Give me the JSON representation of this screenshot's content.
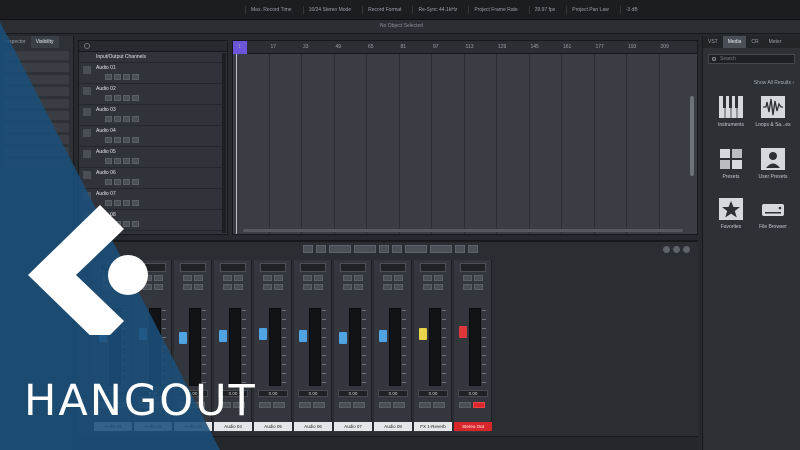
{
  "topbar": {
    "segments": [
      "Max. Record Time",
      "16/24 Stereo Mode",
      "Record Format",
      "Re-Sync 44.1kHz",
      "Project Frame Rate",
      "29.97 fps",
      "Project Pan Law",
      "-3 dB"
    ]
  },
  "subbar": {
    "status": "No Object Selected"
  },
  "inspector": {
    "tabs": [
      {
        "label": "Inspector"
      },
      {
        "label": "Visibility"
      }
    ]
  },
  "tracklist": {
    "folder_label": "Input/Output Channels",
    "tracks": [
      {
        "name": "Audio 01"
      },
      {
        "name": "Audio 02"
      },
      {
        "name": "Audio 03"
      },
      {
        "name": "Audio 04"
      },
      {
        "name": "Audio 05"
      },
      {
        "name": "Audio 06"
      },
      {
        "name": "Audio 07"
      },
      {
        "name": "Audio 08"
      }
    ]
  },
  "ruler": {
    "bars": [
      "1",
      "17",
      "33",
      "49",
      "65",
      "81",
      "97",
      "113",
      "129",
      "145",
      "161",
      "177",
      "193",
      "209"
    ]
  },
  "media": {
    "tabs": [
      {
        "label": "VST"
      },
      {
        "label": "Media"
      },
      {
        "label": "CR"
      },
      {
        "label": "Meter"
      }
    ],
    "search_placeholder": "Search",
    "show_all_link": "Show All Results ›",
    "items": [
      {
        "label": "Instruments",
        "icon": "piano-keys-icon"
      },
      {
        "label": "Loops & Sa...es",
        "icon": "waveform-icon"
      },
      {
        "label": "Presets",
        "icon": "presets-icon"
      },
      {
        "label": "User Presets",
        "icon": "user-presets-icon"
      },
      {
        "label": "Favorites",
        "icon": "star-icon"
      },
      {
        "label": "File Browser",
        "icon": "drive-icon"
      }
    ]
  },
  "mixer": {
    "channels": [
      {
        "name": "Audio 01",
        "value": "0.00"
      },
      {
        "name": "Audio 02",
        "value": "0.00"
      },
      {
        "name": "Audio 03",
        "value": "0.00"
      },
      {
        "name": "Audio 04",
        "value": "0.00"
      },
      {
        "name": "Audio 05",
        "value": "0.00"
      },
      {
        "name": "Audio 06",
        "value": "0.00"
      },
      {
        "name": "Audio 07",
        "value": "0.00"
      },
      {
        "name": "Audio 08",
        "value": "0.00"
      },
      {
        "name": "FX 1-Reverb",
        "value": "0.00"
      },
      {
        "name": "Stereo Out",
        "value": "0.00"
      }
    ]
  },
  "branding": {
    "title": "HANGOUT",
    "logo_icon": "cubase-logo-icon",
    "colors": {
      "banner": "#1a4f7a",
      "logo": "#ffffff"
    }
  }
}
